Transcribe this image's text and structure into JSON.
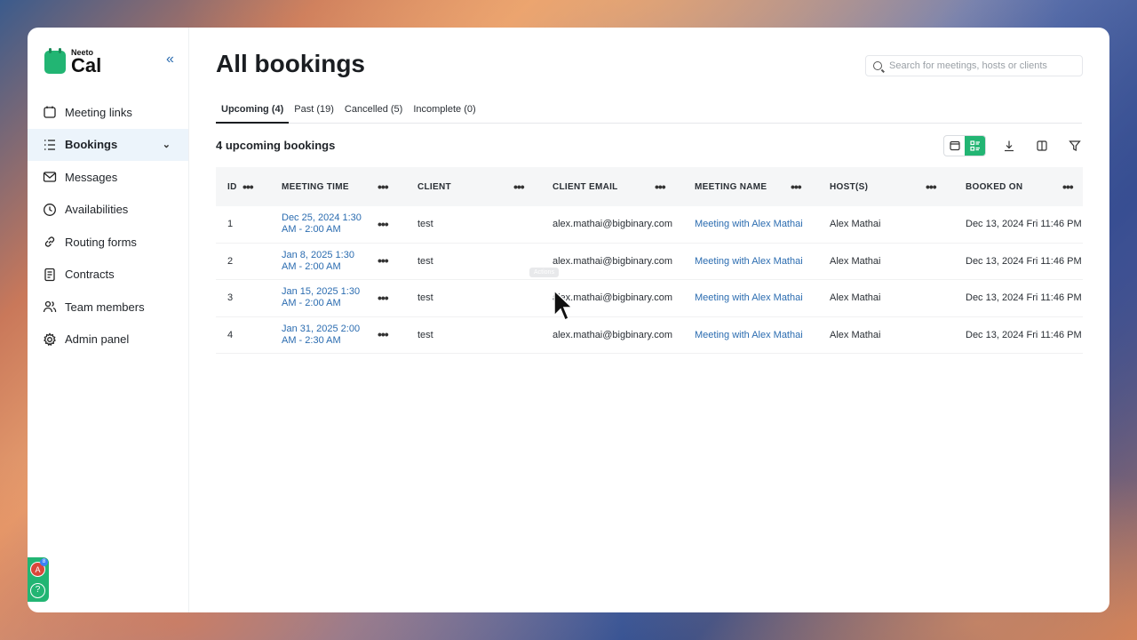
{
  "app": {
    "logo_small": "Neeto",
    "logo_big": "Cal"
  },
  "sidebar": {
    "items": [
      {
        "label": "Meeting links",
        "icon": "calendar-icon",
        "active": false
      },
      {
        "label": "Bookings",
        "icon": "list-icon",
        "active": true
      },
      {
        "label": "Messages",
        "icon": "mail-icon",
        "active": false
      },
      {
        "label": "Availabilities",
        "icon": "clock-icon",
        "active": false
      },
      {
        "label": "Routing forms",
        "icon": "link-icon",
        "active": false
      },
      {
        "label": "Contracts",
        "icon": "document-icon",
        "active": false
      },
      {
        "label": "Team members",
        "icon": "users-icon",
        "active": false
      },
      {
        "label": "Admin panel",
        "icon": "gear-icon",
        "active": false
      }
    ],
    "avatar_letter": "A",
    "notification_count": "8"
  },
  "header": {
    "title": "All bookings",
    "search_placeholder": "Search for meetings, hosts or clients"
  },
  "tabs": [
    {
      "label": "Upcoming (4)",
      "active": true
    },
    {
      "label": "Past (19)",
      "active": false
    },
    {
      "label": "Cancelled (5)",
      "active": false
    },
    {
      "label": "Incomplete (0)",
      "active": false
    }
  ],
  "summary": "4 upcoming bookings",
  "table": {
    "columns": [
      "ID",
      "MEETING TIME",
      "CLIENT",
      "CLIENT EMAIL",
      "MEETING NAME",
      "HOST(S)",
      "BOOKED ON"
    ],
    "rows": [
      {
        "id": "1",
        "time": "Dec 25, 2024 1:30 AM - 2:00 AM",
        "client": "test",
        "email": "alex.mathai@bigbinary.com",
        "meeting": "Meeting with Alex Mathai",
        "host": "Alex Mathai",
        "booked": "Dec 13, 2024 Fri 11:46 PM"
      },
      {
        "id": "2",
        "time": "Jan 8, 2025 1:30 AM - 2:00 AM",
        "client": "test",
        "email": "alex.mathai@bigbinary.com",
        "meeting": "Meeting with Alex Mathai",
        "host": "Alex Mathai",
        "booked": "Dec 13, 2024 Fri 11:46 PM"
      },
      {
        "id": "3",
        "time": "Jan 15, 2025 1:30 AM - 2:00 AM",
        "client": "test",
        "email": "alex.mathai@bigbinary.com",
        "meeting": "Meeting with Alex Mathai",
        "host": "Alex Mathai",
        "booked": "Dec 13, 2024 Fri 11:46 PM"
      },
      {
        "id": "4",
        "time": "Jan 31, 2025 2:00 AM - 2:30 AM",
        "client": "test",
        "email": "alex.mathai@bigbinary.com",
        "meeting": "Meeting with Alex Mathai",
        "host": "Alex Mathai",
        "booked": "Dec 13, 2024 Fri 11:46 PM"
      }
    ]
  },
  "tooltip": "Actions",
  "colors": {
    "brand": "#22b573",
    "link": "#2b6cb0",
    "active_bg": "#ecf4fb"
  }
}
